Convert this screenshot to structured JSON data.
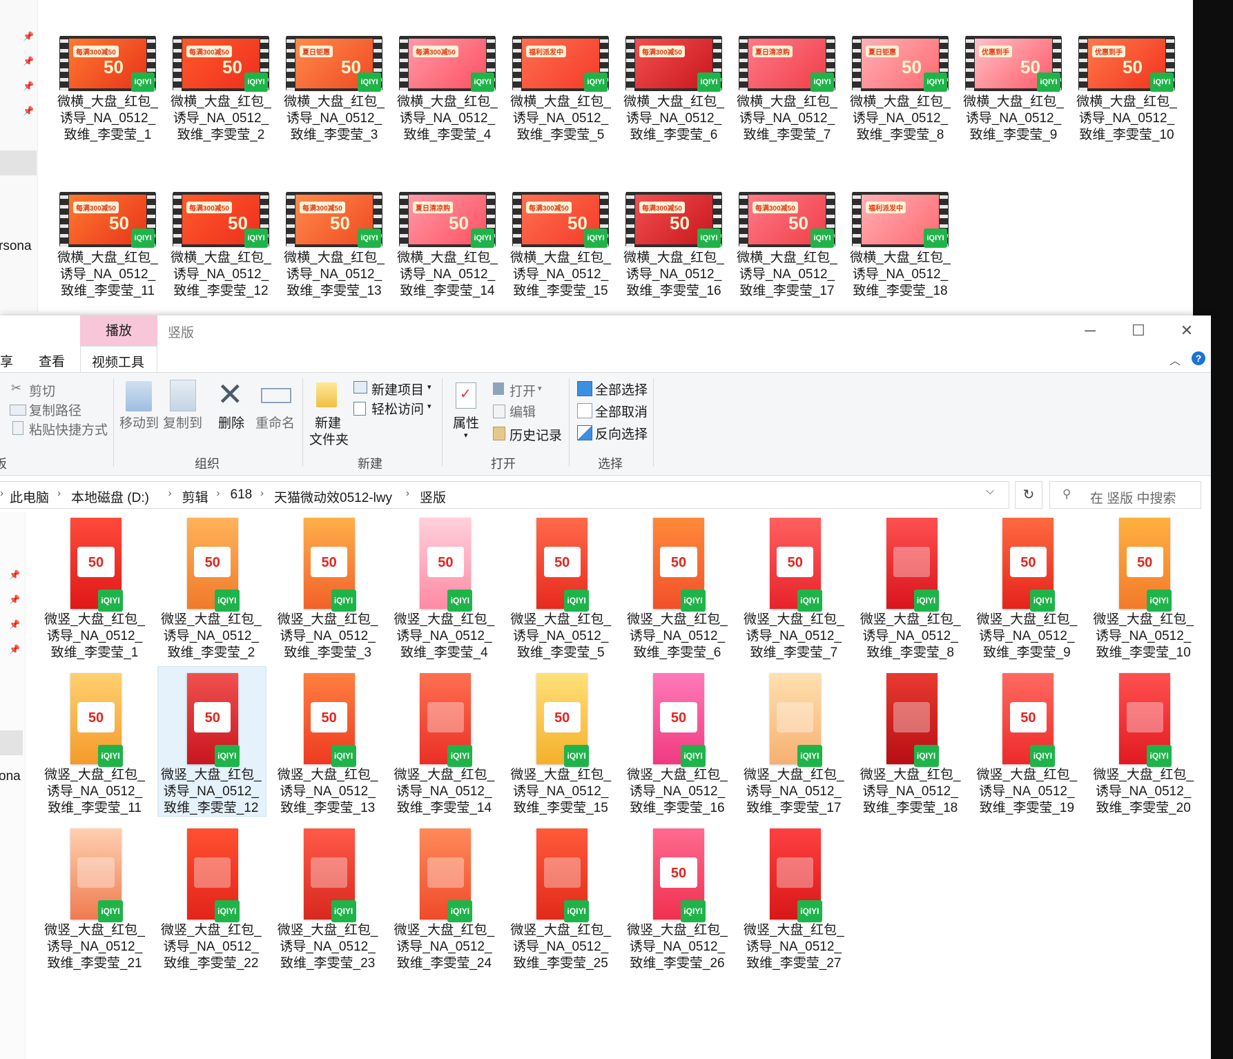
{
  "top_window": {
    "nav_cut_text": "rsona",
    "thumbs": [
      {
        "label": "微横_大盘_红包_\n诱导_NA_0512_\n致维_李雯莹_1",
        "text": "50",
        "tag": "每满300减50"
      },
      {
        "label": "微横_大盘_红包_\n诱导_NA_0512_\n致维_李雯莹_2",
        "text": "50",
        "tag": "每满300减50"
      },
      {
        "label": "微横_大盘_红包_\n诱导_NA_0512_\n致维_李雯莹_3",
        "text": "50",
        "tag": "夏日钜惠"
      },
      {
        "label": "微横_大盘_红包_\n诱导_NA_0512_\n致维_李雯莹_4",
        "text": "",
        "tag": "每满300减50"
      },
      {
        "label": "微横_大盘_红包_\n诱导_NA_0512_\n致维_李雯莹_5",
        "text": "",
        "tag": "福利派发中"
      },
      {
        "label": "微横_大盘_红包_\n诱导_NA_0512_\n致维_李雯莹_6",
        "text": "",
        "tag": "每满300减50"
      },
      {
        "label": "微横_大盘_红包_\n诱导_NA_0512_\n致维_李雯莹_7",
        "text": "",
        "tag": "夏日清凉购"
      },
      {
        "label": "微横_大盘_红包_\n诱导_NA_0512_\n致维_李雯莹_8",
        "text": "50",
        "tag": "夏日钜惠"
      },
      {
        "label": "微横_大盘_红包_\n诱导_NA_0512_\n致维_李雯莹_9",
        "text": "50",
        "tag": "优惠到手"
      },
      {
        "label": "微横_大盘_红包_\n诱导_NA_0512_\n致维_李雯莹_10",
        "text": "50",
        "tag": "优惠到手"
      },
      {
        "label": "微横_大盘_红包_\n诱导_NA_0512_\n致维_李雯莹_11",
        "text": "50",
        "tag": "每满300减50"
      },
      {
        "label": "微横_大盘_红包_\n诱导_NA_0512_\n致维_李雯莹_12",
        "text": "50",
        "tag": "每满300减50"
      },
      {
        "label": "微横_大盘_红包_\n诱导_NA_0512_\n致维_李雯莹_13",
        "text": "50",
        "tag": "每满300减50"
      },
      {
        "label": "微横_大盘_红包_\n诱导_NA_0512_\n致维_李雯莹_14",
        "text": "50",
        "tag": "夏日清凉购"
      },
      {
        "label": "微横_大盘_红包_\n诱导_NA_0512_\n致维_李雯莹_15",
        "text": "50",
        "tag": "每满300减50"
      },
      {
        "label": "微横_大盘_红包_\n诱导_NA_0512_\n致维_李雯莹_16",
        "text": "50",
        "tag": "每满300减50"
      },
      {
        "label": "微横_大盘_红包_\n诱导_NA_0512_\n致维_李雯莹_17",
        "text": "50",
        "tag": "每满300减50"
      },
      {
        "label": "微横_大盘_红包_\n诱导_NA_0512_\n致维_李雯莹_18",
        "text": "",
        "tag": "福利派发中"
      }
    ]
  },
  "explorer": {
    "ctx_tab": "播放",
    "title": "竖版",
    "tabs": {
      "share_cut": "享",
      "view": "查看",
      "video_tools": "视频工具"
    },
    "ribbon": {
      "cut": "剪切",
      "copy_path": "复制路径",
      "paste_shortcut": "粘贴快捷方式",
      "clip_cut": "板",
      "move_to": "移动到",
      "copy_to": "复制到",
      "delete": "删除",
      "rename": "重命名",
      "group_organize": "组织",
      "new_item": "新建项目",
      "easy_access": "轻松访问",
      "new_folder_1": "新建",
      "new_folder_2": "文件夹",
      "group_new": "新建",
      "properties": "属性",
      "open": "打开",
      "edit": "编辑",
      "history": "历史记录",
      "group_open": "打开",
      "select_all": "全部选择",
      "select_none": "全部取消",
      "invert": "反向选择",
      "group_select": "选择"
    },
    "breadcrumb": [
      "此电脑",
      "本地磁盘 (D:)",
      "剪辑",
      "618",
      "天猫微动效0512-lwy",
      "竖版"
    ],
    "search_placeholder": "在 竖版 中搜索",
    "nav_cut_text": "ona",
    "selected_index": 11,
    "thumbs": [
      {
        "label": "微竖_大盘_红包_\n诱导_NA_0512_\n致维_李雯莹_1",
        "text": "50"
      },
      {
        "label": "微竖_大盘_红包_\n诱导_NA_0512_\n致维_李雯莹_2",
        "text": "50"
      },
      {
        "label": "微竖_大盘_红包_\n诱导_NA_0512_\n致维_李雯莹_3",
        "text": "50"
      },
      {
        "label": "微竖_大盘_红包_\n诱导_NA_0512_\n致维_李雯莹_4",
        "text": "50"
      },
      {
        "label": "微竖_大盘_红包_\n诱导_NA_0512_\n致维_李雯莹_5",
        "text": "50"
      },
      {
        "label": "微竖_大盘_红包_\n诱导_NA_0512_\n致维_李雯莹_6",
        "text": "50"
      },
      {
        "label": "微竖_大盘_红包_\n诱导_NA_0512_\n致维_李雯莹_7",
        "text": "50"
      },
      {
        "label": "微竖_大盘_红包_\n诱导_NA_0512_\n致维_李雯莹_8",
        "text": ""
      },
      {
        "label": "微竖_大盘_红包_\n诱导_NA_0512_\n致维_李雯莹_9",
        "text": "50"
      },
      {
        "label": "微竖_大盘_红包_\n诱导_NA_0512_\n致维_李雯莹_10",
        "text": "50"
      },
      {
        "label": "微竖_大盘_红包_\n诱导_NA_0512_\n致维_李雯莹_11",
        "text": "50"
      },
      {
        "label": "微竖_大盘_红包_\n诱导_NA_0512_\n致维_李雯莹_12",
        "text": "50"
      },
      {
        "label": "微竖_大盘_红包_\n诱导_NA_0512_\n致维_李雯莹_13",
        "text": "50"
      },
      {
        "label": "微竖_大盘_红包_\n诱导_NA_0512_\n致维_李雯莹_14",
        "text": ""
      },
      {
        "label": "微竖_大盘_红包_\n诱导_NA_0512_\n致维_李雯莹_15",
        "text": "50"
      },
      {
        "label": "微竖_大盘_红包_\n诱导_NA_0512_\n致维_李雯莹_16",
        "text": "50"
      },
      {
        "label": "微竖_大盘_红包_\n诱导_NA_0512_\n致维_李雯莹_17",
        "text": ""
      },
      {
        "label": "微竖_大盘_红包_\n诱导_NA_0512_\n致维_李雯莹_18",
        "text": ""
      },
      {
        "label": "微竖_大盘_红包_\n诱导_NA_0512_\n致维_李雯莹_19",
        "text": "50"
      },
      {
        "label": "微竖_大盘_红包_\n诱导_NA_0512_\n致维_李雯莹_20",
        "text": ""
      },
      {
        "label": "微竖_大盘_红包_\n诱导_NA_0512_\n致维_李雯莹_21",
        "text": ""
      },
      {
        "label": "微竖_大盘_红包_\n诱导_NA_0512_\n致维_李雯莹_22",
        "text": ""
      },
      {
        "label": "微竖_大盘_红包_\n诱导_NA_0512_\n致维_李雯莹_23",
        "text": ""
      },
      {
        "label": "微竖_大盘_红包_\n诱导_NA_0512_\n致维_李雯莹_24",
        "text": ""
      },
      {
        "label": "微竖_大盘_红包_\n诱导_NA_0512_\n致维_李雯莹_25",
        "text": ""
      },
      {
        "label": "微竖_大盘_红包_\n诱导_NA_0512_\n致维_李雯莹_26",
        "text": "50"
      },
      {
        "label": "微竖_大盘_红包_\n诱导_NA_0512_\n致维_李雯莹_27",
        "text": ""
      }
    ]
  },
  "badge_text": "iQIYI",
  "colors": {
    "badge": "#1fb44a",
    "ctx_tab": "#f7c6d9",
    "selection": "#e5f1fb",
    "help": "#1a73d9"
  }
}
